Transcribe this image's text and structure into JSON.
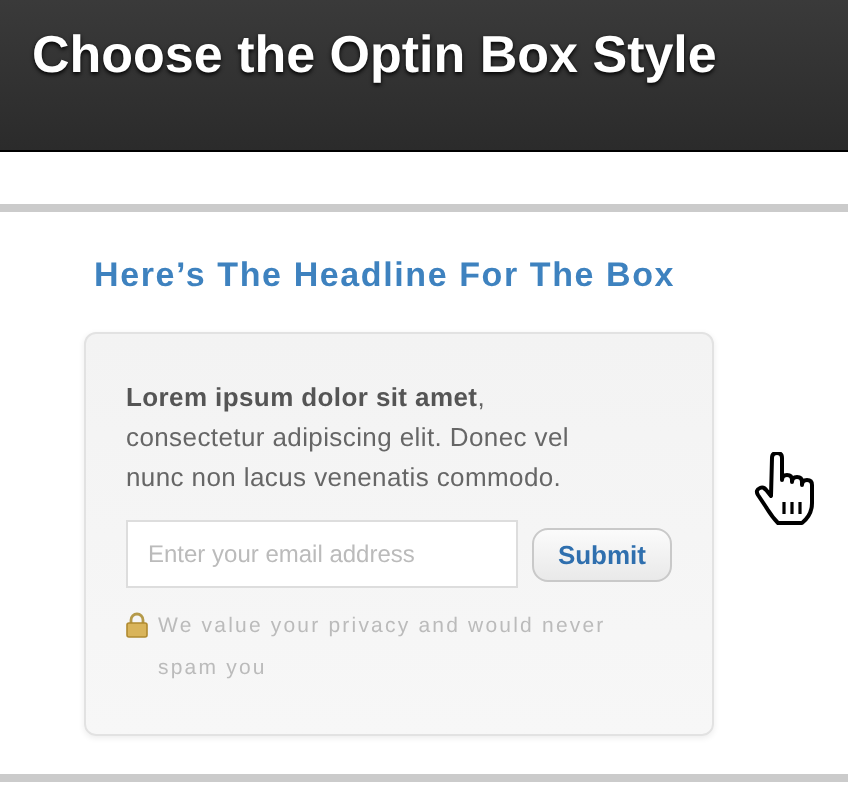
{
  "header": {
    "title": "Choose the Optin Box Style"
  },
  "optin": {
    "headline": "Here’s The Headline For The Box",
    "body": "**Lorem ipsum dolor sit amet**, consectetur adipiscing elit. Donec vel nunc non lacus venenatis commodo.",
    "email_field": {
      "placeholder": "Enter your email address"
    },
    "submit_button": "Submit",
    "privacy_note": "We value your privacy and would never spam you"
  }
}
